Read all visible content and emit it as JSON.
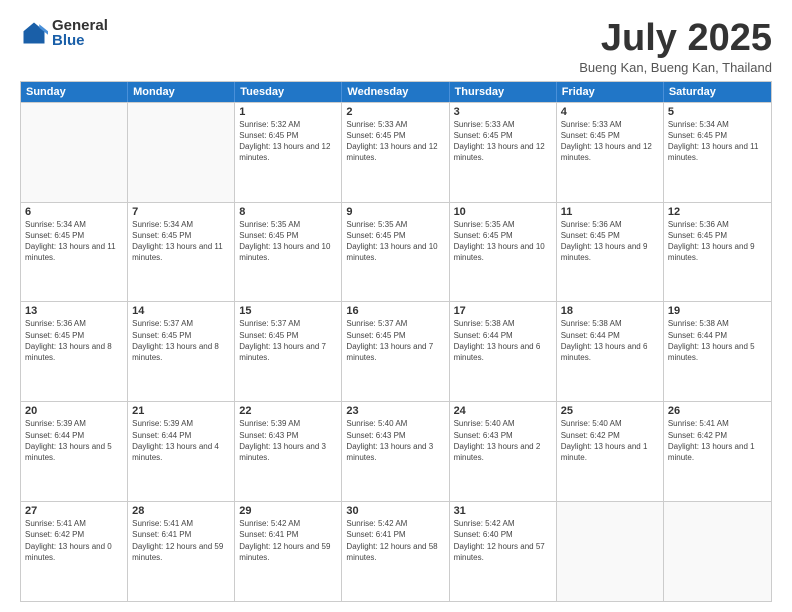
{
  "logo": {
    "general": "General",
    "blue": "Blue"
  },
  "title": "July 2025",
  "subtitle": "Bueng Kan, Bueng Kan, Thailand",
  "headers": [
    "Sunday",
    "Monday",
    "Tuesday",
    "Wednesday",
    "Thursday",
    "Friday",
    "Saturday"
  ],
  "weeks": [
    [
      {
        "day": "",
        "sunrise": "",
        "sunset": "",
        "daylight": ""
      },
      {
        "day": "",
        "sunrise": "",
        "sunset": "",
        "daylight": ""
      },
      {
        "day": "1",
        "sunrise": "Sunrise: 5:32 AM",
        "sunset": "Sunset: 6:45 PM",
        "daylight": "Daylight: 13 hours and 12 minutes."
      },
      {
        "day": "2",
        "sunrise": "Sunrise: 5:33 AM",
        "sunset": "Sunset: 6:45 PM",
        "daylight": "Daylight: 13 hours and 12 minutes."
      },
      {
        "day": "3",
        "sunrise": "Sunrise: 5:33 AM",
        "sunset": "Sunset: 6:45 PM",
        "daylight": "Daylight: 13 hours and 12 minutes."
      },
      {
        "day": "4",
        "sunrise": "Sunrise: 5:33 AM",
        "sunset": "Sunset: 6:45 PM",
        "daylight": "Daylight: 13 hours and 12 minutes."
      },
      {
        "day": "5",
        "sunrise": "Sunrise: 5:34 AM",
        "sunset": "Sunset: 6:45 PM",
        "daylight": "Daylight: 13 hours and 11 minutes."
      }
    ],
    [
      {
        "day": "6",
        "sunrise": "Sunrise: 5:34 AM",
        "sunset": "Sunset: 6:45 PM",
        "daylight": "Daylight: 13 hours and 11 minutes."
      },
      {
        "day": "7",
        "sunrise": "Sunrise: 5:34 AM",
        "sunset": "Sunset: 6:45 PM",
        "daylight": "Daylight: 13 hours and 11 minutes."
      },
      {
        "day": "8",
        "sunrise": "Sunrise: 5:35 AM",
        "sunset": "Sunset: 6:45 PM",
        "daylight": "Daylight: 13 hours and 10 minutes."
      },
      {
        "day": "9",
        "sunrise": "Sunrise: 5:35 AM",
        "sunset": "Sunset: 6:45 PM",
        "daylight": "Daylight: 13 hours and 10 minutes."
      },
      {
        "day": "10",
        "sunrise": "Sunrise: 5:35 AM",
        "sunset": "Sunset: 6:45 PM",
        "daylight": "Daylight: 13 hours and 10 minutes."
      },
      {
        "day": "11",
        "sunrise": "Sunrise: 5:36 AM",
        "sunset": "Sunset: 6:45 PM",
        "daylight": "Daylight: 13 hours and 9 minutes."
      },
      {
        "day": "12",
        "sunrise": "Sunrise: 5:36 AM",
        "sunset": "Sunset: 6:45 PM",
        "daylight": "Daylight: 13 hours and 9 minutes."
      }
    ],
    [
      {
        "day": "13",
        "sunrise": "Sunrise: 5:36 AM",
        "sunset": "Sunset: 6:45 PM",
        "daylight": "Daylight: 13 hours and 8 minutes."
      },
      {
        "day": "14",
        "sunrise": "Sunrise: 5:37 AM",
        "sunset": "Sunset: 6:45 PM",
        "daylight": "Daylight: 13 hours and 8 minutes."
      },
      {
        "day": "15",
        "sunrise": "Sunrise: 5:37 AM",
        "sunset": "Sunset: 6:45 PM",
        "daylight": "Daylight: 13 hours and 7 minutes."
      },
      {
        "day": "16",
        "sunrise": "Sunrise: 5:37 AM",
        "sunset": "Sunset: 6:45 PM",
        "daylight": "Daylight: 13 hours and 7 minutes."
      },
      {
        "day": "17",
        "sunrise": "Sunrise: 5:38 AM",
        "sunset": "Sunset: 6:44 PM",
        "daylight": "Daylight: 13 hours and 6 minutes."
      },
      {
        "day": "18",
        "sunrise": "Sunrise: 5:38 AM",
        "sunset": "Sunset: 6:44 PM",
        "daylight": "Daylight: 13 hours and 6 minutes."
      },
      {
        "day": "19",
        "sunrise": "Sunrise: 5:38 AM",
        "sunset": "Sunset: 6:44 PM",
        "daylight": "Daylight: 13 hours and 5 minutes."
      }
    ],
    [
      {
        "day": "20",
        "sunrise": "Sunrise: 5:39 AM",
        "sunset": "Sunset: 6:44 PM",
        "daylight": "Daylight: 13 hours and 5 minutes."
      },
      {
        "day": "21",
        "sunrise": "Sunrise: 5:39 AM",
        "sunset": "Sunset: 6:44 PM",
        "daylight": "Daylight: 13 hours and 4 minutes."
      },
      {
        "day": "22",
        "sunrise": "Sunrise: 5:39 AM",
        "sunset": "Sunset: 6:43 PM",
        "daylight": "Daylight: 13 hours and 3 minutes."
      },
      {
        "day": "23",
        "sunrise": "Sunrise: 5:40 AM",
        "sunset": "Sunset: 6:43 PM",
        "daylight": "Daylight: 13 hours and 3 minutes."
      },
      {
        "day": "24",
        "sunrise": "Sunrise: 5:40 AM",
        "sunset": "Sunset: 6:43 PM",
        "daylight": "Daylight: 13 hours and 2 minutes."
      },
      {
        "day": "25",
        "sunrise": "Sunrise: 5:40 AM",
        "sunset": "Sunset: 6:42 PM",
        "daylight": "Daylight: 13 hours and 1 minute."
      },
      {
        "day": "26",
        "sunrise": "Sunrise: 5:41 AM",
        "sunset": "Sunset: 6:42 PM",
        "daylight": "Daylight: 13 hours and 1 minute."
      }
    ],
    [
      {
        "day": "27",
        "sunrise": "Sunrise: 5:41 AM",
        "sunset": "Sunset: 6:42 PM",
        "daylight": "Daylight: 13 hours and 0 minutes."
      },
      {
        "day": "28",
        "sunrise": "Sunrise: 5:41 AM",
        "sunset": "Sunset: 6:41 PM",
        "daylight": "Daylight: 12 hours and 59 minutes."
      },
      {
        "day": "29",
        "sunrise": "Sunrise: 5:42 AM",
        "sunset": "Sunset: 6:41 PM",
        "daylight": "Daylight: 12 hours and 59 minutes."
      },
      {
        "day": "30",
        "sunrise": "Sunrise: 5:42 AM",
        "sunset": "Sunset: 6:41 PM",
        "daylight": "Daylight: 12 hours and 58 minutes."
      },
      {
        "day": "31",
        "sunrise": "Sunrise: 5:42 AM",
        "sunset": "Sunset: 6:40 PM",
        "daylight": "Daylight: 12 hours and 57 minutes."
      },
      {
        "day": "",
        "sunrise": "",
        "sunset": "",
        "daylight": ""
      },
      {
        "day": "",
        "sunrise": "",
        "sunset": "",
        "daylight": ""
      }
    ]
  ]
}
